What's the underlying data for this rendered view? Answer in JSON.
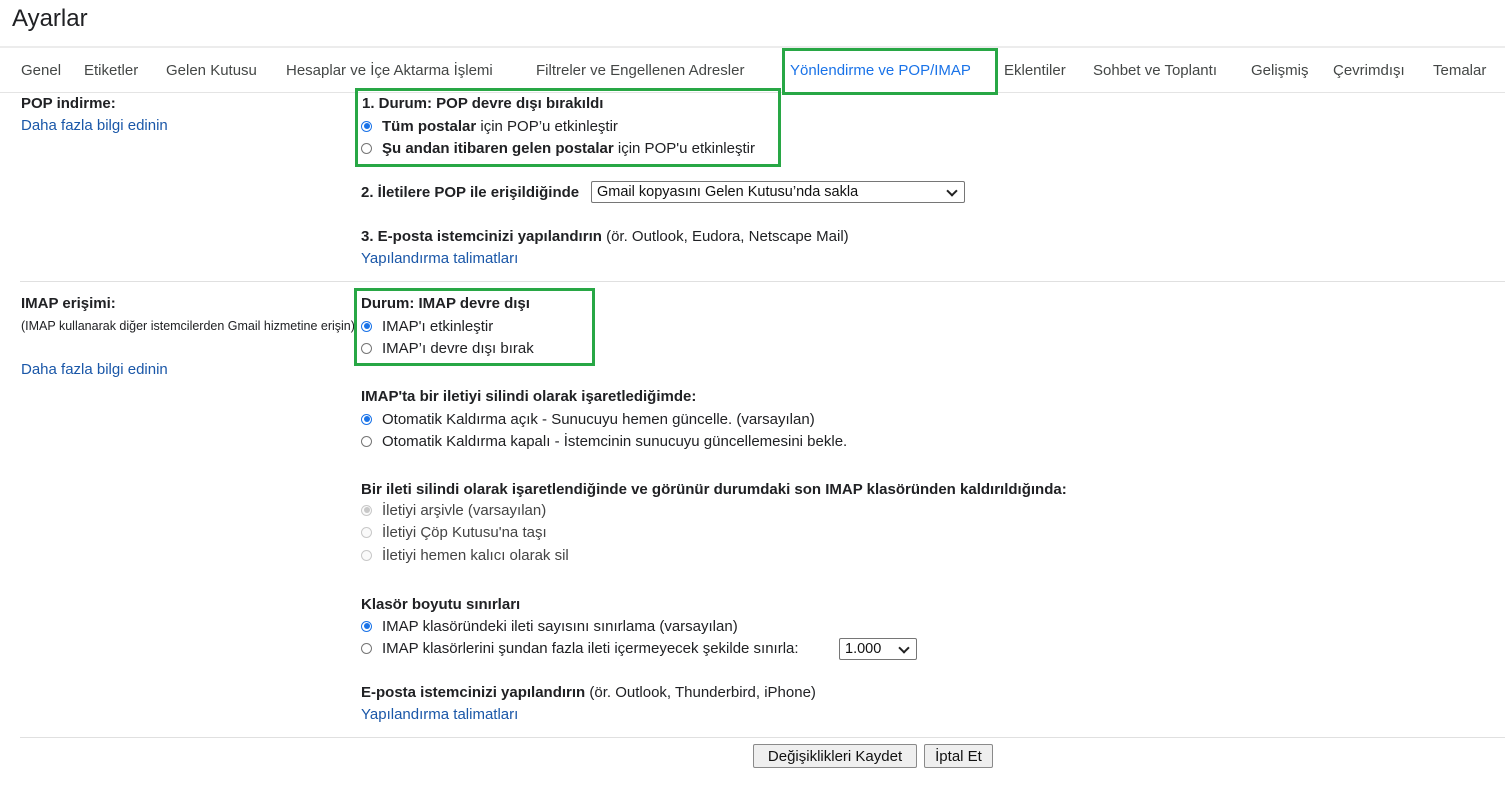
{
  "page": {
    "title": "Ayarlar"
  },
  "tabs": [
    {
      "label": "Genel"
    },
    {
      "label": "Etiketler"
    },
    {
      "label": "Gelen Kutusu"
    },
    {
      "label": "Hesaplar ve İçe Aktarma İşlemi"
    },
    {
      "label": "Filtreler ve Engellenen Adresler"
    },
    {
      "label": "Yönlendirme ve POP/IMAP"
    },
    {
      "label": "Eklentiler"
    },
    {
      "label": "Sohbet ve Toplantı"
    },
    {
      "label": "Gelişmiş"
    },
    {
      "label": "Çevrimdışı"
    },
    {
      "label": "Temalar"
    }
  ],
  "active_tab": "Yönlendirme ve POP/IMAP",
  "pop": {
    "label": "POP indirme:",
    "link": "Daha fazla bilgi edinin",
    "status": "1. Durum: POP devre dışı bırakıldı",
    "opt1_bold": "Tüm postalar",
    "opt1_rest": " için POP’u etkinleştir",
    "opt2_bold": "Şu andan itibaren gelen postalar",
    "opt2_rest": " için POP'u etkinleştir",
    "access_label": "2. İletilere POP ile erişildiğinde",
    "access_select": "Gmail kopyasını Gelen Kutusu’nda sakla",
    "configure_bold": "3. E-posta istemcinizi yapılandırın",
    "configure_rest": " (ör. Outlook, Eudora, Netscape Mail)",
    "configure_link": "Yapılandırma talimatları"
  },
  "imap": {
    "label": "IMAP erişimi:",
    "description": "(IMAP kullanarak diğer istemcilerden Gmail hizmetine erişin)",
    "link": "Daha fazla bilgi edinin",
    "status": "Durum: IMAP devre dışı",
    "enable": "IMAP'ı etkinleştir",
    "disable": "IMAP’ı devre dışı bırak",
    "delete_header": "IMAP'ta bir iletiyi silindi olarak işaretlediğimde:",
    "expunge_on": "Otomatik Kaldırma açık - Sunucuyu hemen güncelle. (varsayılan)",
    "expunge_off": "Otomatik Kaldırma kapalı - İstemcinin sunucuyu güncellemesini bekle.",
    "expunged_header": "Bir ileti silindi olarak işaretlendiğinde ve görünür durumdaki son IMAP klasöründen kaldırıldığında:",
    "archive": "İletiyi arşivle (varsayılan)",
    "trash": "İletiyi Çöp Kutusu'na taşı",
    "delete_forever": "İletiyi hemen kalıcı olarak sil",
    "folder_header": "Klasör boyutu sınırları",
    "no_limit": "IMAP klasöründeki ileti sayısını sınırlama (varsayılan)",
    "limit": "IMAP klasörlerini şundan fazla ileti içermeyecek şekilde sınırla:",
    "limit_value": "1.000",
    "configure_bold": "E-posta istemcinizi yapılandırın",
    "configure_rest": " (ör. Outlook, Thunderbird, iPhone)",
    "configure_link": "Yapılandırma talimatları"
  },
  "footer": {
    "save": "Değişiklikleri Kaydet",
    "cancel": "İptal Et"
  },
  "colors": {
    "highlight": "#28a745",
    "active_tab": "#1a73e8",
    "link": "#1a57a8",
    "radio_selected": "#1a73e8"
  }
}
